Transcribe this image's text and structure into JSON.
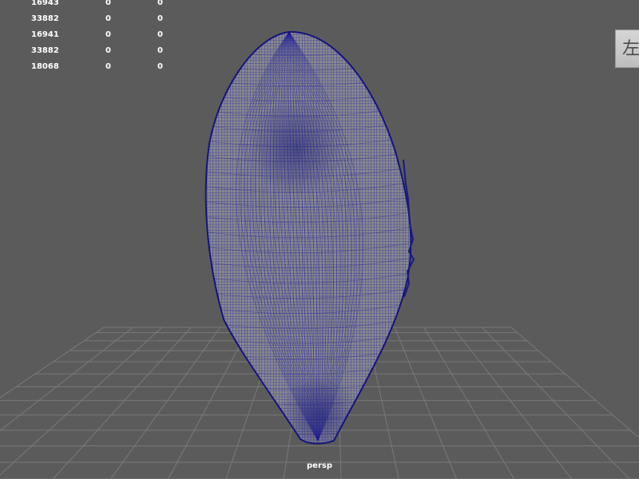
{
  "hud": {
    "rows": [
      {
        "a": "16943",
        "b": "0",
        "c": "0"
      },
      {
        "a": "33882",
        "b": "0",
        "c": "0"
      },
      {
        "a": "16941",
        "b": "0",
        "c": "0"
      },
      {
        "a": "33882",
        "b": "0",
        "c": "0"
      },
      {
        "a": "18068",
        "b": "0",
        "c": "0"
      }
    ]
  },
  "view_cube": {
    "label": "左"
  },
  "camera": {
    "name": "persp"
  },
  "colors": {
    "background": "#5b5b5b",
    "grid": "#7a7a7a",
    "mesh_fill": "#8a8a8e",
    "mesh_wire": "#1c1c96"
  },
  "icons": {
    "view_cube": "view-cube-icon"
  }
}
